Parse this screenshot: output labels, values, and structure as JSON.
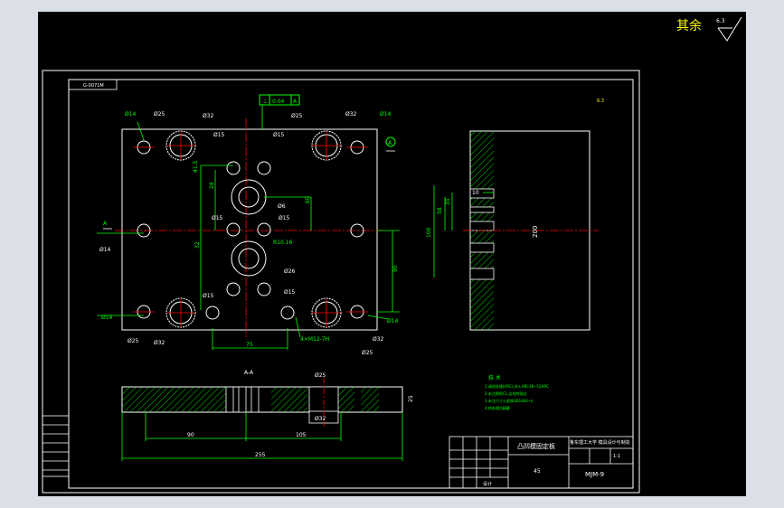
{
  "finish": {
    "label": "其余",
    "roughness": "6.3"
  },
  "frame": {
    "part_code_box": "G-0071M"
  },
  "tolerance": {
    "symbol": "⊥",
    "value": "0.04",
    "datum": "A"
  },
  "diameters": {
    "d14": "Ø14",
    "d25": "Ø25",
    "d32": "Ø32",
    "d15": "Ø15",
    "d6": "Ø6",
    "d26": "Ø26",
    "r10_16": "R10.16",
    "d32_bottom": "Ø32",
    "thread": "4×M12-7H",
    "note_bottom": "6×Ø28"
  },
  "dimensions": {
    "d41_5": "41.5",
    "d28": "28",
    "d32": "32",
    "d60": "60",
    "d90": "90",
    "d75": "75",
    "d58": "58",
    "d100": "100",
    "d200": "200",
    "d10": "10",
    "d35": "35",
    "d255": "255",
    "d105": "105",
    "d25": "25"
  },
  "section_label": "A-A",
  "section_mark": "A",
  "tech_req": {
    "title": "技 术",
    "lines": [
      "1.调质处理(HRC),淬火HRC48~52HRC",
      "2.未注倒角C1,去毛刺锐边",
      "3.未注尺寸公差按GB1804-m",
      "4.热处理后精磨"
    ]
  },
  "title_block": {
    "part_name": "凸凹模固定板",
    "material": "45",
    "school": "鲁东理工大学 模具设计与制造",
    "drawing_no": "MJM-9",
    "scale": "1:1",
    "designer": "设计"
  },
  "colors": {
    "background": "#000000",
    "outline": "#ffffff",
    "dimension": "#00ff00",
    "center": "#ff0000",
    "hatch": "#00ff00",
    "highlight": "#ffff00"
  }
}
